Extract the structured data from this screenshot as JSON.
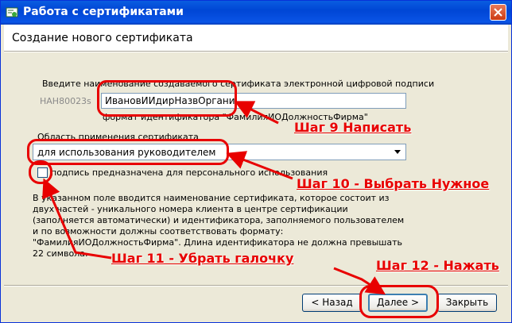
{
  "window": {
    "title": "Работа с сертификатами",
    "header_title": "Создание нового сертификата"
  },
  "form": {
    "name_label": "Введите наименование создаваемого сертификата электронной цифровой подписи",
    "prefix": "НАН80023s",
    "name_value": "ИвановИИдирНазвОргани",
    "format_hint": "формат идентификатора \"ФамилияИОДолжностьФирма\"",
    "scope_label": "Область применения сертификата",
    "scope_value": "для использования руководителем",
    "personal_checkbox_label": "подпись предназначена для персонального использования",
    "personal_checked": false,
    "description": "В указанном поле вводится наименование сертификата, которое состоит из двух частей - уникального номера клиента в центре сертификации (заполняется автоматически) и идентификатора, заполняемого пользователем и по возможности должны соответствовать формату: \"ФамилияИОДолжностьФирма\". Длина идентификатора не должна превышать 22 символа."
  },
  "buttons": {
    "back": "< Назад",
    "next": "Далее >",
    "close": "Закрыть"
  },
  "annotations": {
    "step9": "Шаг 9 Написать",
    "step10": "Шаг 10 - Выбрать Нужное",
    "step11": "Шаг 11 - Убрать галочку",
    "step12": "Шаг 12 - Нажать"
  },
  "colors": {
    "annotation": "#e80000",
    "titlebar": "#0046d5",
    "dialog_bg": "#ece9d8"
  }
}
